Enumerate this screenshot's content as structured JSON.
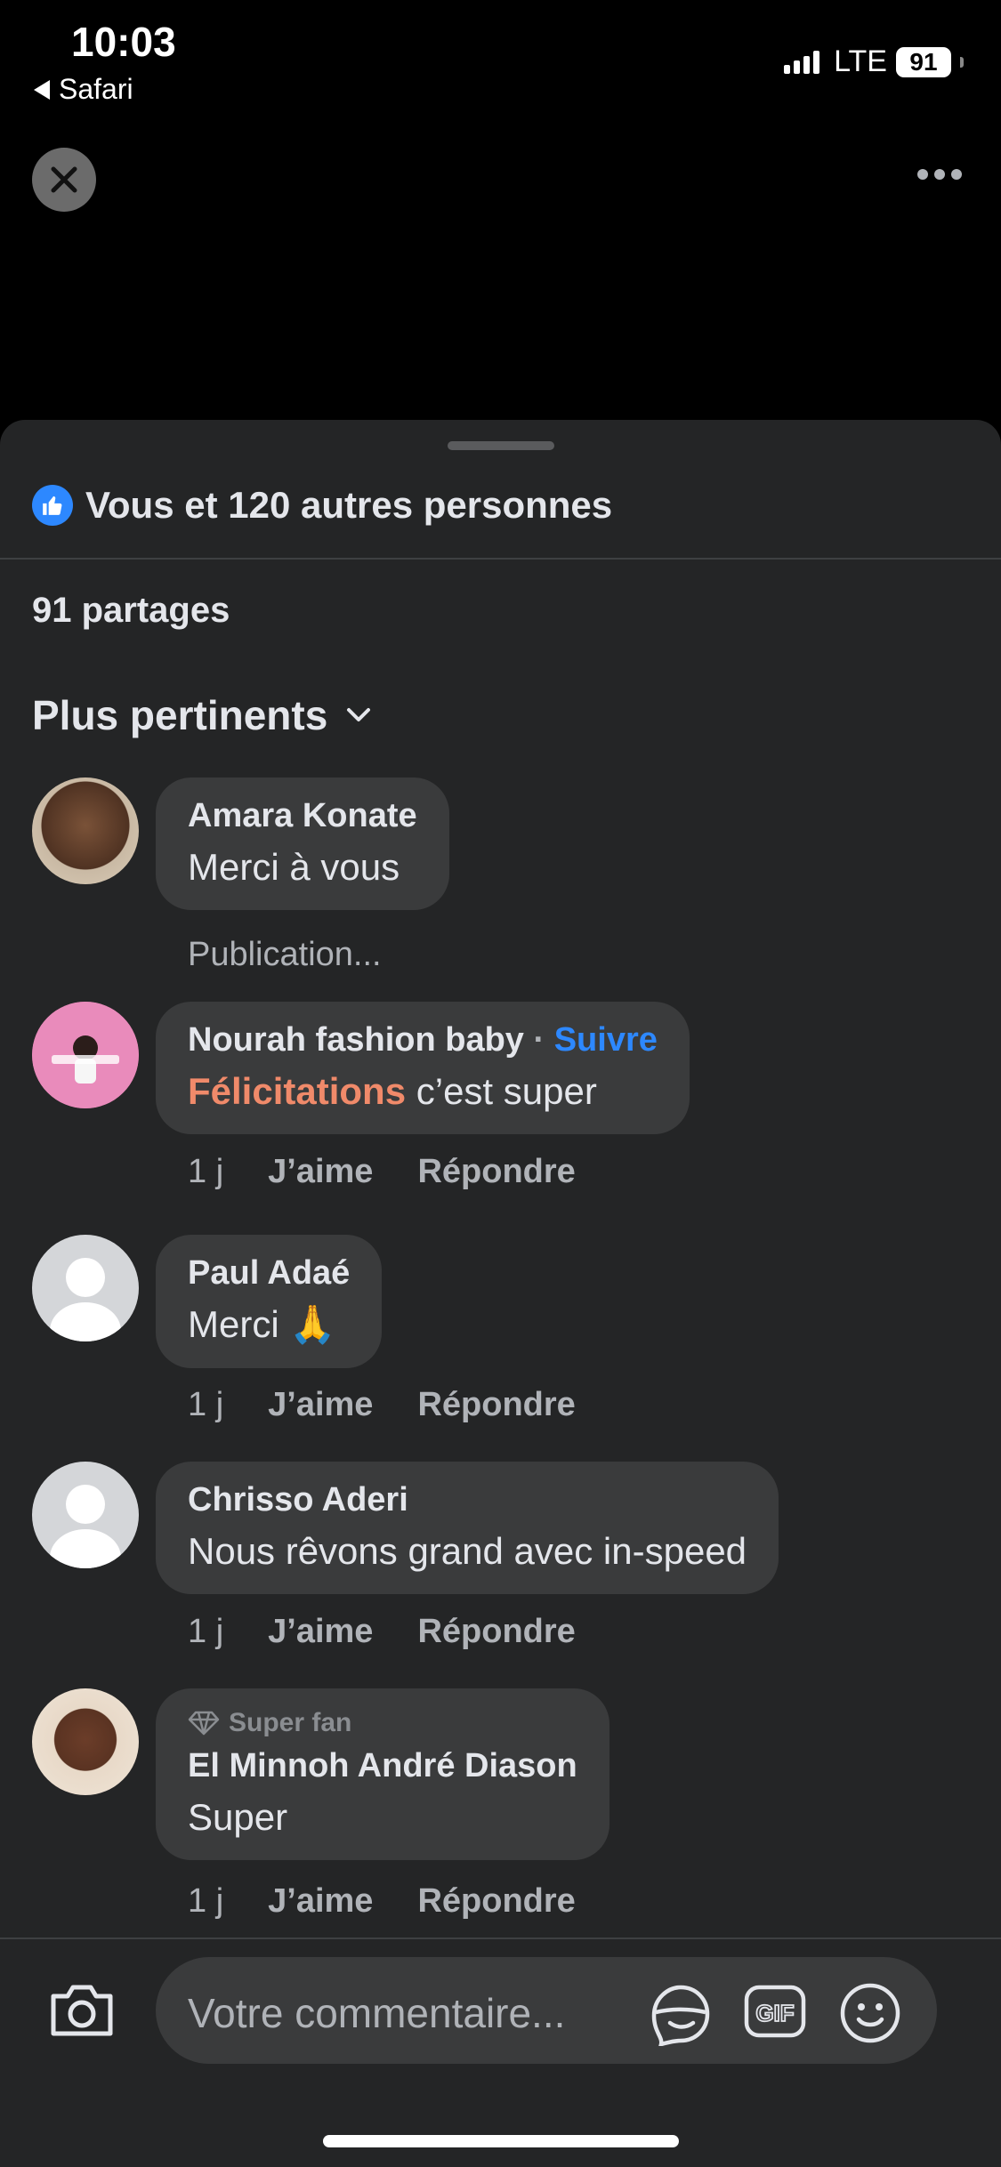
{
  "status_bar": {
    "time": "10:03",
    "back_app": "Safari",
    "network": "LTE",
    "battery": "91"
  },
  "sheet": {
    "reactions_text": "Vous et 120 autres personnes",
    "shares_text": "91 partages",
    "sort_label": "Plus pertinents"
  },
  "comments": [
    {
      "author": "Amara Konate",
      "text": "Merci à vous",
      "sub": "Publication..."
    },
    {
      "author": "Nourah fashion baby",
      "separator": "·",
      "follow": "Suivre",
      "text_highlight": "Félicitations",
      "text_rest": " c’est super",
      "time": "1 j",
      "like": "J’aime",
      "reply": "Répondre"
    },
    {
      "author": "Paul Adaé",
      "text": "Merci 🙏",
      "time": "1 j",
      "like": "J’aime",
      "reply": "Répondre"
    },
    {
      "author": "Chrisso Aderi",
      "text": "Nous rêvons grand avec in-speed",
      "time": "1 j",
      "like": "J’aime",
      "reply": "Répondre"
    },
    {
      "badge": "Super fan",
      "author": "El Minnoh André Diason",
      "text": "Super",
      "time": "1 j",
      "like": "J’aime",
      "reply": "Répondre"
    }
  ],
  "composer": {
    "placeholder": "Votre commentaire..."
  },
  "colors": {
    "accent": "#2d88ff",
    "sheet_bg": "#242526",
    "bubble_bg": "#3a3b3c",
    "highlight": "#f08a6a"
  },
  "icons": [
    "close-icon",
    "more-icon",
    "like-icon",
    "chevron-down-icon",
    "camera-icon",
    "sticker-icon",
    "gif-icon",
    "emoji-icon",
    "diamond-icon"
  ]
}
